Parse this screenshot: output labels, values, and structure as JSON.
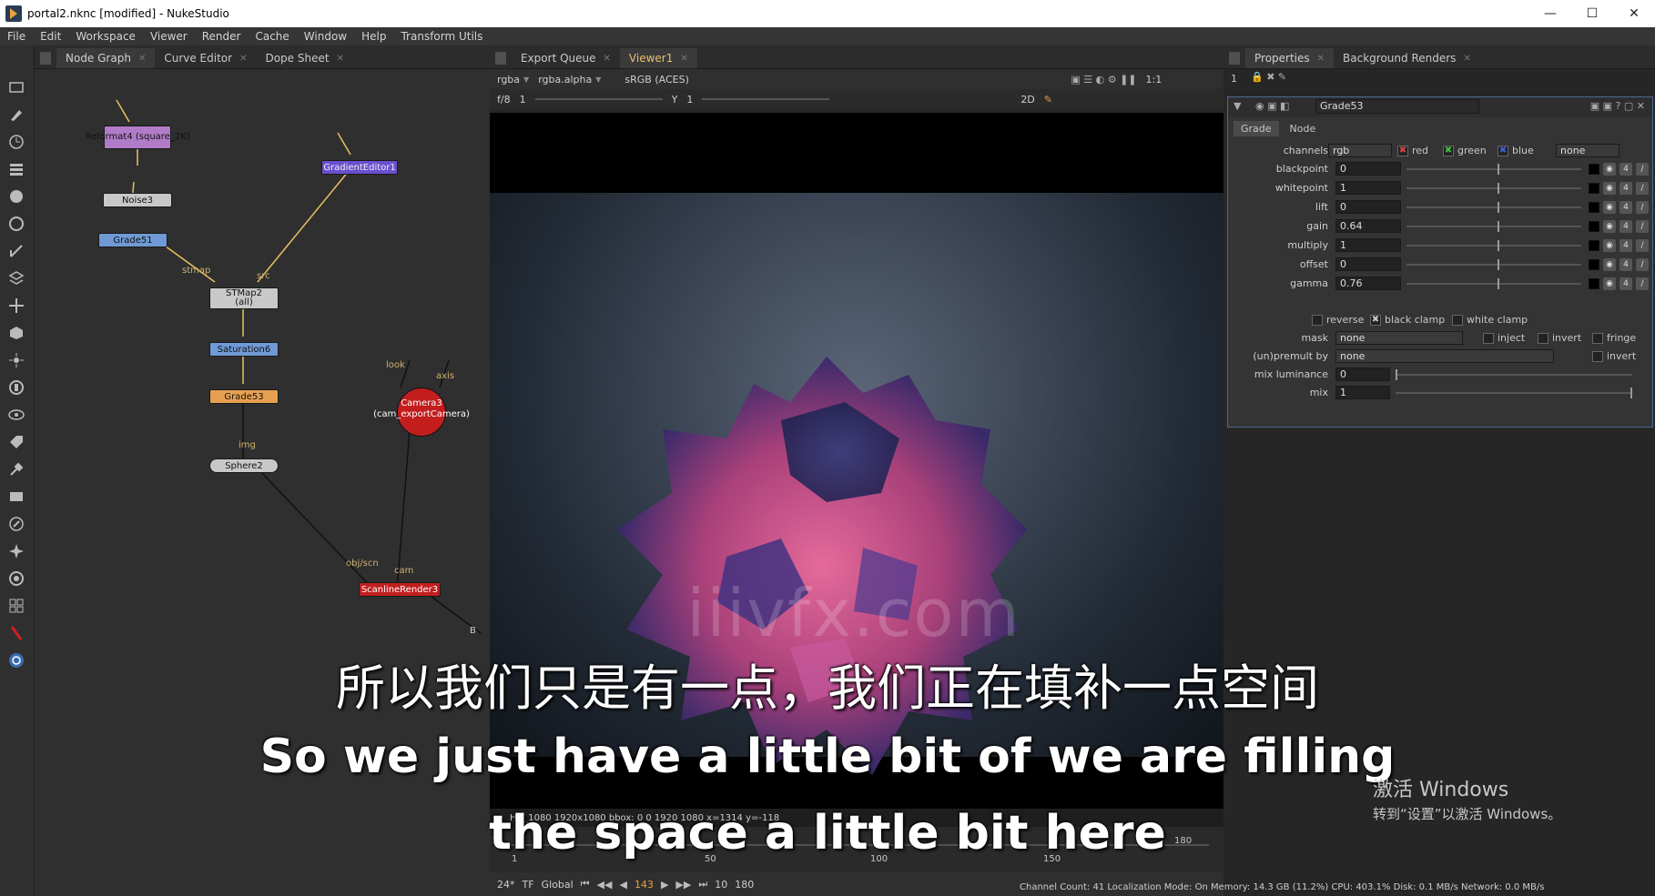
{
  "window": {
    "title": "portal2.nknc [modified] - NukeStudio",
    "minimize": "—",
    "maximize": "☐",
    "close": "✕"
  },
  "menu": [
    "File",
    "Edit",
    "Workspace",
    "Viewer",
    "Render",
    "Cache",
    "Window",
    "Help",
    "Transform Utils"
  ],
  "left_panel": {
    "tabs": [
      "Node Graph",
      "Curve Editor",
      "Dope Sheet"
    ]
  },
  "nodes": {
    "reformat": "Reformat4\n(square_2K)",
    "noise": "Noise3",
    "grade51": "Grade51",
    "gradient": "GradientEditor1",
    "stmap": "STMap2\n(all)",
    "saturation": "Saturation6",
    "grade53": "Grade53",
    "sphere": "Sphere2",
    "camera": "Camera3\n(cam_exportCamera)",
    "scanline": "ScanlineRender3"
  },
  "edge_labels": {
    "stmap": "stmap",
    "src": "src",
    "look": "look",
    "axis": "axis",
    "img": "img",
    "obj_scn": "obj/scn",
    "cam": "cam",
    "b": "B"
  },
  "viewer": {
    "tabs": [
      "Export Queue",
      "Viewer1"
    ],
    "channels": "rgba",
    "alpha": "rgba.alpha",
    "colorspace": "sRGB (ACES)",
    "zoom": "1:1",
    "fstop": "f/8",
    "gain_val": "1",
    "gamma_label": "Y",
    "gamma_val": "1",
    "mode": "2D",
    "info": "HD_1080 1920x1080  bbox: 0 0 1920 1080 x=1314 y=-118",
    "watermark": "iiivfx.com"
  },
  "timeline": {
    "ticks": [
      "1",
      "50",
      "100",
      "150"
    ],
    "start": "1",
    "end": "180",
    "fps": "24*",
    "tf": "TF",
    "scope": "Global",
    "current_frame": "143",
    "step": "10",
    "out": "180"
  },
  "properties": {
    "tabs": [
      "Properties",
      "Background Renders"
    ],
    "count": "1",
    "node_name": "Grade53",
    "subtabs": [
      "Grade",
      "Node"
    ],
    "channels": {
      "label": "channels",
      "value": "rgb",
      "red": "red",
      "green": "green",
      "blue": "blue",
      "extra": "none"
    },
    "rows": [
      {
        "label": "blackpoint",
        "value": "0"
      },
      {
        "label": "whitepoint",
        "value": "1"
      },
      {
        "label": "lift",
        "value": "0"
      },
      {
        "label": "gain",
        "value": "0.64"
      },
      {
        "label": "multiply",
        "value": "1"
      },
      {
        "label": "offset",
        "value": "0"
      },
      {
        "label": "gamma",
        "value": "0.76"
      }
    ],
    "reverse": "reverse",
    "black_clamp": "black clamp",
    "white_clamp": "white clamp",
    "mask": {
      "label": "mask",
      "value": "none",
      "inject": "inject",
      "invert": "invert",
      "fringe": "fringe"
    },
    "unpremult": {
      "label": "(un)premult by",
      "value": "none",
      "invert": "invert"
    },
    "mix_luminance": {
      "label": "mix luminance",
      "value": "0"
    },
    "mix": {
      "label": "mix",
      "value": "1"
    }
  },
  "subtitles": {
    "chinese": "所以我们只是有一点，我们正在填补一点空间",
    "english_1": "So we just have a little bit of we are filling",
    "english_2": "the space a little bit here"
  },
  "activate_windows": {
    "line1": "激活 Windows",
    "line2": "转到“设置”以激活 Windows。"
  },
  "status": "Channel Count: 41  Localization Mode: On  Memory: 14.3 GB (11.2%)  CPU: 403.1%  Disk: 0.1 MB/s  Network: 0.0 MB/s",
  "colors": {
    "accent": "#e8c070",
    "node_reformat": "#b07cc8",
    "node_grade": "#6f9ad6",
    "node_gradient": "#6a4fd0",
    "node_grade53": "#e6a050",
    "camera": "#c21e1e",
    "scanline": "#c21e1e"
  }
}
